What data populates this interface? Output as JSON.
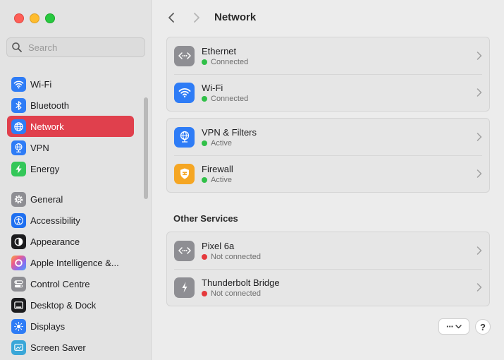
{
  "window": {
    "title": "Network"
  },
  "colors": {
    "accent": "#e0404d",
    "connected": "#30c048",
    "disconnected": "#e5393c"
  },
  "search": {
    "placeholder": "Search"
  },
  "sidebar": {
    "group1": [
      {
        "label": "Wi-Fi",
        "icon": "wifi-icon",
        "color": "#2e7cf6",
        "selected": false
      },
      {
        "label": "Bluetooth",
        "icon": "bluetooth-icon",
        "color": "#2e7cf6",
        "selected": false
      },
      {
        "label": "Network",
        "icon": "globe-icon",
        "color": "#2e7cf6",
        "selected": true
      },
      {
        "label": "VPN",
        "icon": "vpn-globe-icon",
        "color": "#2e7cf6",
        "selected": false
      },
      {
        "label": "Energy",
        "icon": "lightning-icon",
        "color": "#34c759",
        "selected": false
      }
    ],
    "group2": [
      {
        "label": "General",
        "icon": "gear-icon",
        "color": "#8e8e93"
      },
      {
        "label": "Accessibility",
        "icon": "accessibility-icon",
        "color": "#1e6ff0"
      },
      {
        "label": "Appearance",
        "icon": "appearance-icon",
        "color": "#1c1c1e"
      },
      {
        "label": "Apple Intelligence &...",
        "icon": "apple-intelligence-icon",
        "color": "#f08a5d"
      },
      {
        "label": "Control Centre",
        "icon": "toggles-icon",
        "color": "#8e8e93"
      },
      {
        "label": "Desktop & Dock",
        "icon": "dock-icon",
        "color": "#1c1c1e"
      },
      {
        "label": "Displays",
        "icon": "sun-icon",
        "color": "#2e7cf6"
      },
      {
        "label": "Screen Saver",
        "icon": "screensaver-icon",
        "color": "#3aa7d8"
      }
    ]
  },
  "main": {
    "services": [
      {
        "name": "Ethernet",
        "status": "Connected",
        "state": "on",
        "icon": "ethernet-icon",
        "color": "#8e8e93"
      },
      {
        "name": "Wi-Fi",
        "status": "Connected",
        "state": "on",
        "icon": "wifi-icon",
        "color": "#2e7cf6"
      }
    ],
    "services2": [
      {
        "name": "VPN & Filters",
        "status": "Active",
        "state": "on",
        "icon": "vpn-globe-icon",
        "color": "#2e7cf6"
      },
      {
        "name": "Firewall",
        "status": "Active",
        "state": "on",
        "icon": "firewall-icon",
        "color": "#f5a623"
      }
    ],
    "other_heading": "Other Services",
    "other_services": [
      {
        "name": "Pixel 6a",
        "status": "Not connected",
        "state": "off",
        "icon": "ethernet-icon",
        "color": "#8e8e93"
      },
      {
        "name": "Thunderbolt Bridge",
        "status": "Not connected",
        "state": "off",
        "icon": "thunderbolt-icon",
        "color": "#8e8e93"
      }
    ],
    "more_label": "···",
    "help_label": "?"
  }
}
